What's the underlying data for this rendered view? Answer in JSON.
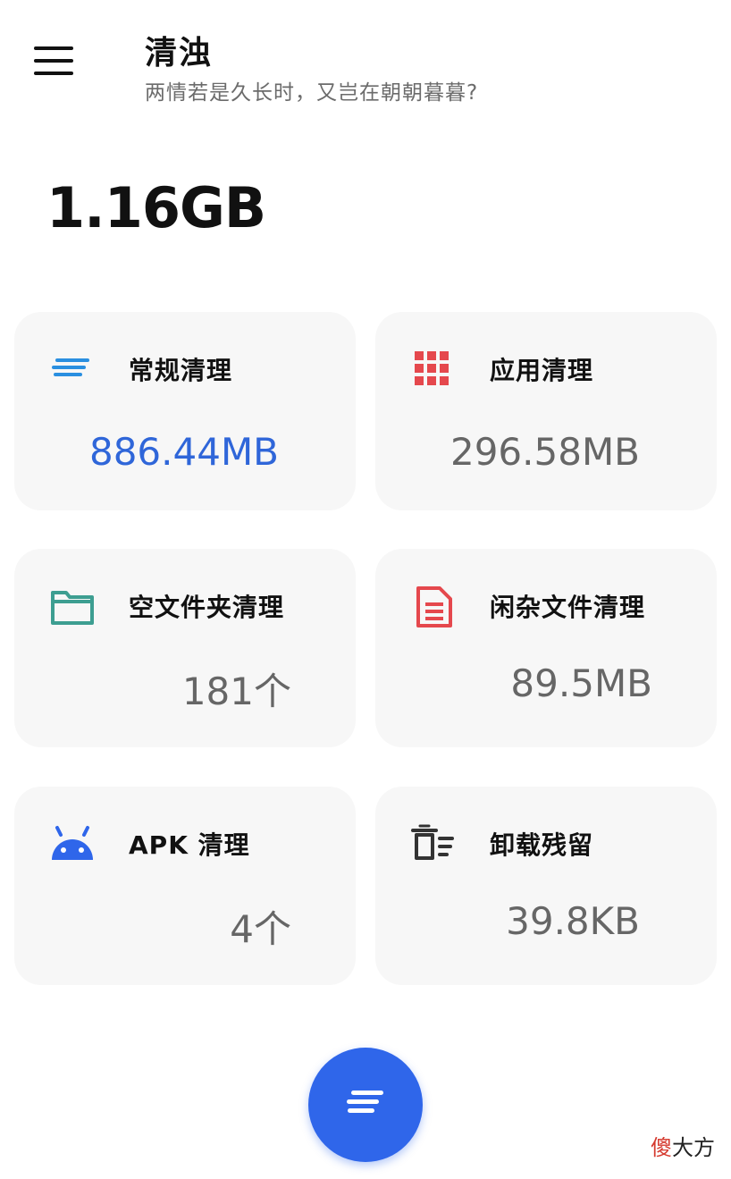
{
  "header": {
    "title": "清浊",
    "subtitle": "两情若是久长时，又岂在朝朝暮暮?"
  },
  "summary": {
    "total_size": "1.16GB"
  },
  "cards": [
    {
      "label": "常规清理",
      "value": "886.44MB",
      "icon": "lines-icon",
      "icon_color": "#2a8fe0",
      "value_color": "#2f66d9"
    },
    {
      "label": "应用清理",
      "value": "296.58MB",
      "icon": "grid-icon",
      "icon_color": "#e5484d"
    },
    {
      "label": "空文件夹清理",
      "value": "181个",
      "icon": "folder-icon",
      "icon_color": "#3d9e91"
    },
    {
      "label": "闲杂文件清理",
      "value": "89.5MB",
      "icon": "document-icon",
      "icon_color": "#e5484d"
    },
    {
      "label": "APK 清理",
      "value": "4个",
      "icon": "android-icon",
      "icon_color": "#2f66ea"
    },
    {
      "label": "卸载残留",
      "value": "39.8KB",
      "icon": "trash-icon",
      "icon_color": "#333333"
    }
  ],
  "fab": {
    "icon": "lines-icon",
    "color": "#2f66ea"
  },
  "watermark": {
    "first_char": "傻",
    "rest": "大方"
  }
}
